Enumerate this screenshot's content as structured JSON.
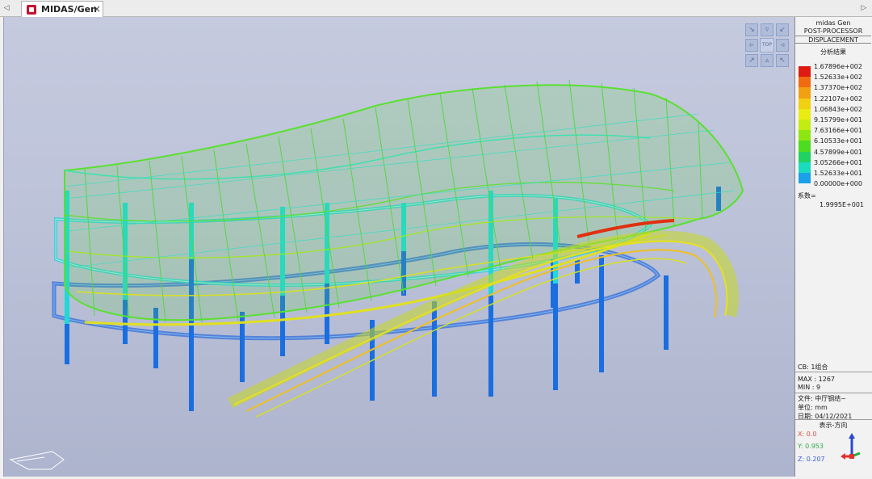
{
  "tabs": {
    "left_arrow": "◁",
    "right_arrow": "▷",
    "doc_title": "MIDAS/Gen",
    "close": "×"
  },
  "view_cube": {
    "top_label": "TOP"
  },
  "panel": {
    "app_name": "midas Gen",
    "mode": "POST-PROCESSOR",
    "result_type": "DISPLACEMENT",
    "caption": "分析结果",
    "legend": [
      {
        "value": "1.67896e+002",
        "color": "#e01a10"
      },
      {
        "value": "1.52633e+002",
        "color": "#f06a10"
      },
      {
        "value": "1.37370e+002",
        "color": "#f0a010"
      },
      {
        "value": "1.22107e+002",
        "color": "#f0d010"
      },
      {
        "value": "1.06843e+002",
        "color": "#e8ec10"
      },
      {
        "value": "9.15799e+001",
        "color": "#c4ec10"
      },
      {
        "value": "7.63166e+001",
        "color": "#8ee610"
      },
      {
        "value": "6.10533e+001",
        "color": "#4cdc20"
      },
      {
        "value": "4.57899e+001",
        "color": "#20d260"
      },
      {
        "value": "3.05266e+001",
        "color": "#18dcc0"
      },
      {
        "value": "1.52633e+001",
        "color": "#1aa0e8"
      },
      {
        "value": "0.00000e+000",
        "color": "#1a60e0"
      }
    ],
    "factor_label": "系数=",
    "factor_value": "1.9995E+001",
    "cb": "CB: 1组合",
    "max": "MAX : 1267",
    "min": "MIN : 9",
    "file": "文件: 中厅钢结~",
    "unit": "单位: mm",
    "date": "日期: 04/12/2021",
    "dir_title": "表示-方向",
    "x": "X: 0.0",
    "y": "Y: 0.953",
    "z": "Z: 0.207"
  },
  "colors": {
    "column_blue": "#1a6ee0",
    "cyan": "#20e0e0",
    "green": "#5ae020",
    "yellow": "#e0e020",
    "red": "#e03010"
  }
}
